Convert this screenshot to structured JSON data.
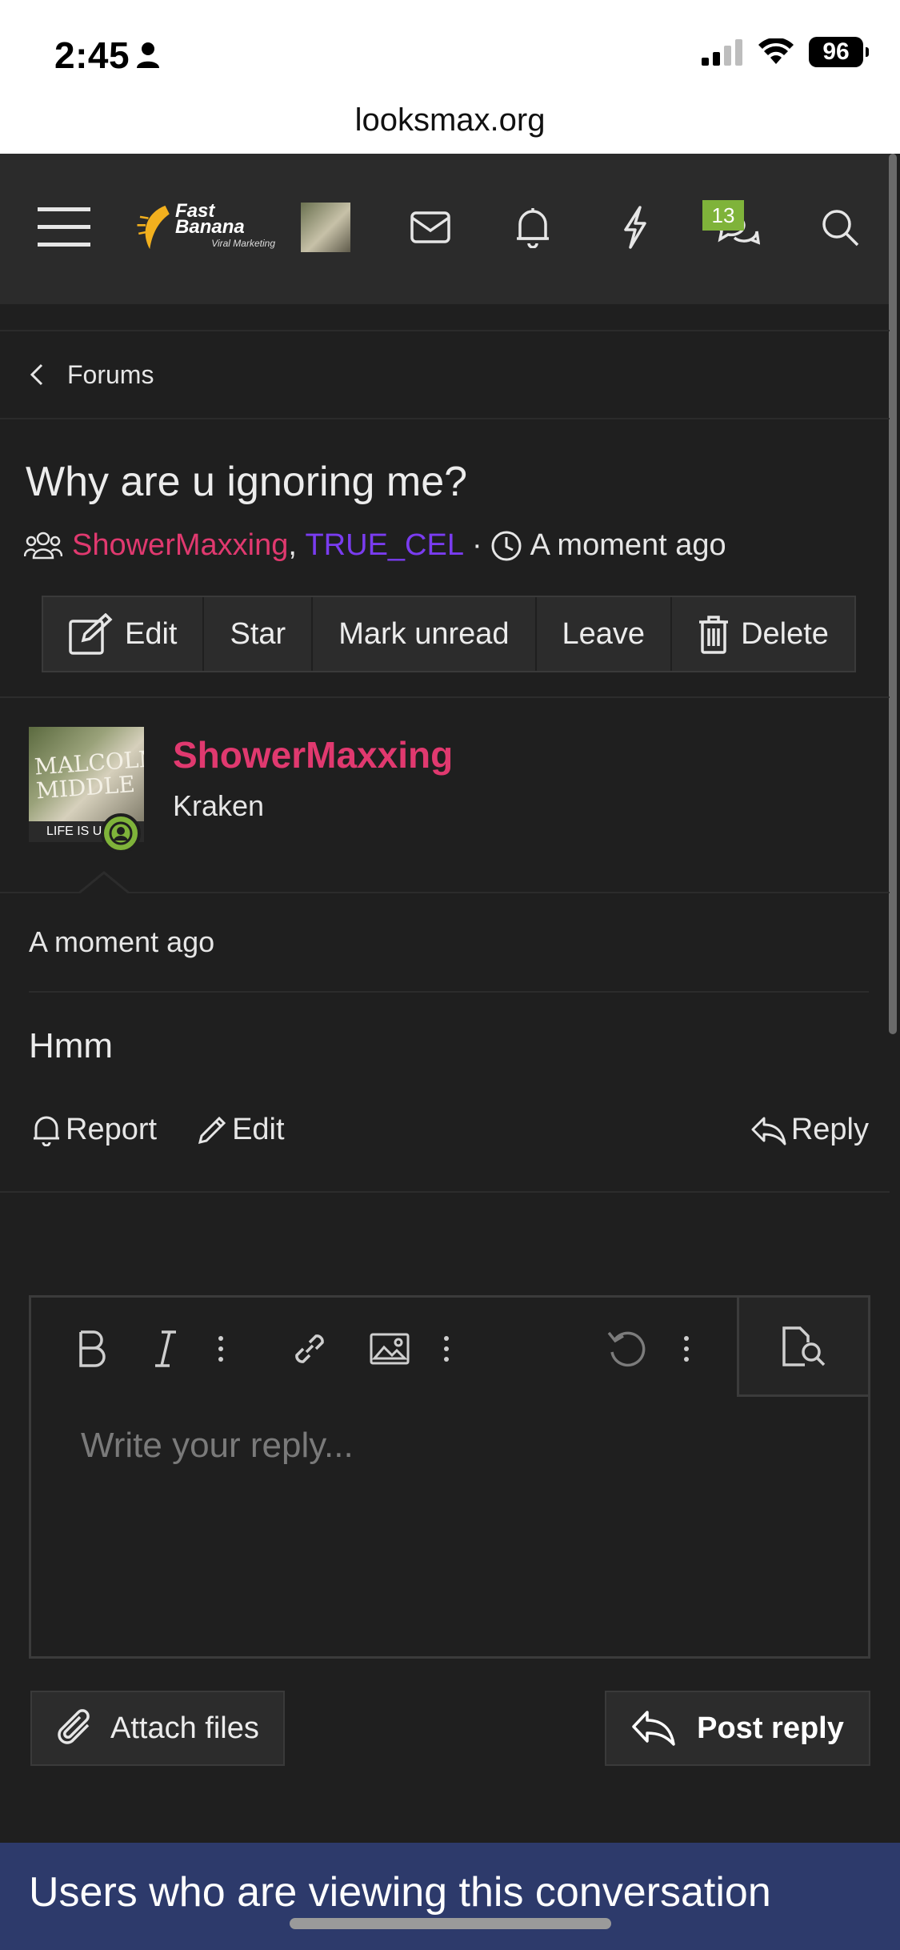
{
  "status_bar": {
    "time": "2:45",
    "battery": "96"
  },
  "browser": {
    "url": "looksmax.org"
  },
  "navbar": {
    "logo_text": "Fast Banana",
    "logo_subtext": "Viral Marketing",
    "conversations_badge": "13",
    "icons": [
      "menu-icon",
      "mail-icon",
      "bell-icon",
      "bolt-icon",
      "chat-icon",
      "search-icon"
    ]
  },
  "breadcrumb": {
    "label": "Forums"
  },
  "conversation": {
    "title": "Why are u ignoring me?",
    "participant_1": "ShowerMaxxing",
    "participant_2": "TRUE_CEL",
    "separator": "·",
    "time": "A moment ago",
    "participant_colors": {
      "primary": "#e0396f",
      "secondary": "#7a3cf0"
    }
  },
  "actions": {
    "edit": "Edit",
    "star": "Star",
    "mark_unread": "Mark unread",
    "leave": "Leave",
    "delete": "Delete"
  },
  "message": {
    "author": "ShowerMaxxing",
    "author_title": "Kraken",
    "avatar_text": "MALCOLM MIDDLE",
    "avatar_caption": "LIFE IS UI",
    "time": "A moment ago",
    "body": "Hmm",
    "report_label": "Report",
    "edit_label": "Edit",
    "reply_label": "Reply"
  },
  "editor": {
    "placeholder": "Write your reply...",
    "attach_label": "Attach files",
    "post_reply_label": "Post reply"
  },
  "footer": {
    "banner_text": "Users who are viewing this conversation",
    "banner_color": "#2d3a6b"
  }
}
